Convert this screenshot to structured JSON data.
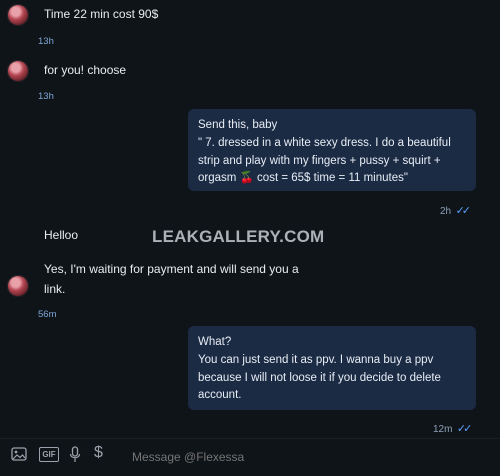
{
  "messages": [
    {
      "text": "Time  22 min  cost 90$",
      "time": "13h"
    },
    {
      "text": "for you! choose",
      "time": "13h"
    },
    {
      "lines": [
        "Send this, baby",
        "\" 7. dressed in a white sexy dress. I do a beautiful strip and play with my fingers + pussy + squirt + orgasm 🍒 cost = 65$ time = 11 minutes\""
      ],
      "time": "2h"
    },
    {
      "text": "Helloo"
    },
    {
      "text": "Yes, I'm waiting for payment and will send you a link.",
      "time": "56m"
    },
    {
      "lines": [
        "What?",
        "You can just send it as ppv. I wanna buy a ppv because I will not loose it if you decide to delete account."
      ],
      "time": "12m"
    }
  ],
  "watermark": "LEAKGALLERY.COM",
  "composer": {
    "placeholder": "Message @Flexessa",
    "icons": [
      "image-icon",
      "gif-icon",
      "microphone-icon",
      "dollar-icon"
    ],
    "gif_label": "GIF",
    "dollar_label": "$"
  },
  "read_ticks": "✓✓",
  "colors": {
    "background": "#0f1418",
    "outgoing_bubble": "#1b2b44",
    "tick": "#5da0ff"
  }
}
